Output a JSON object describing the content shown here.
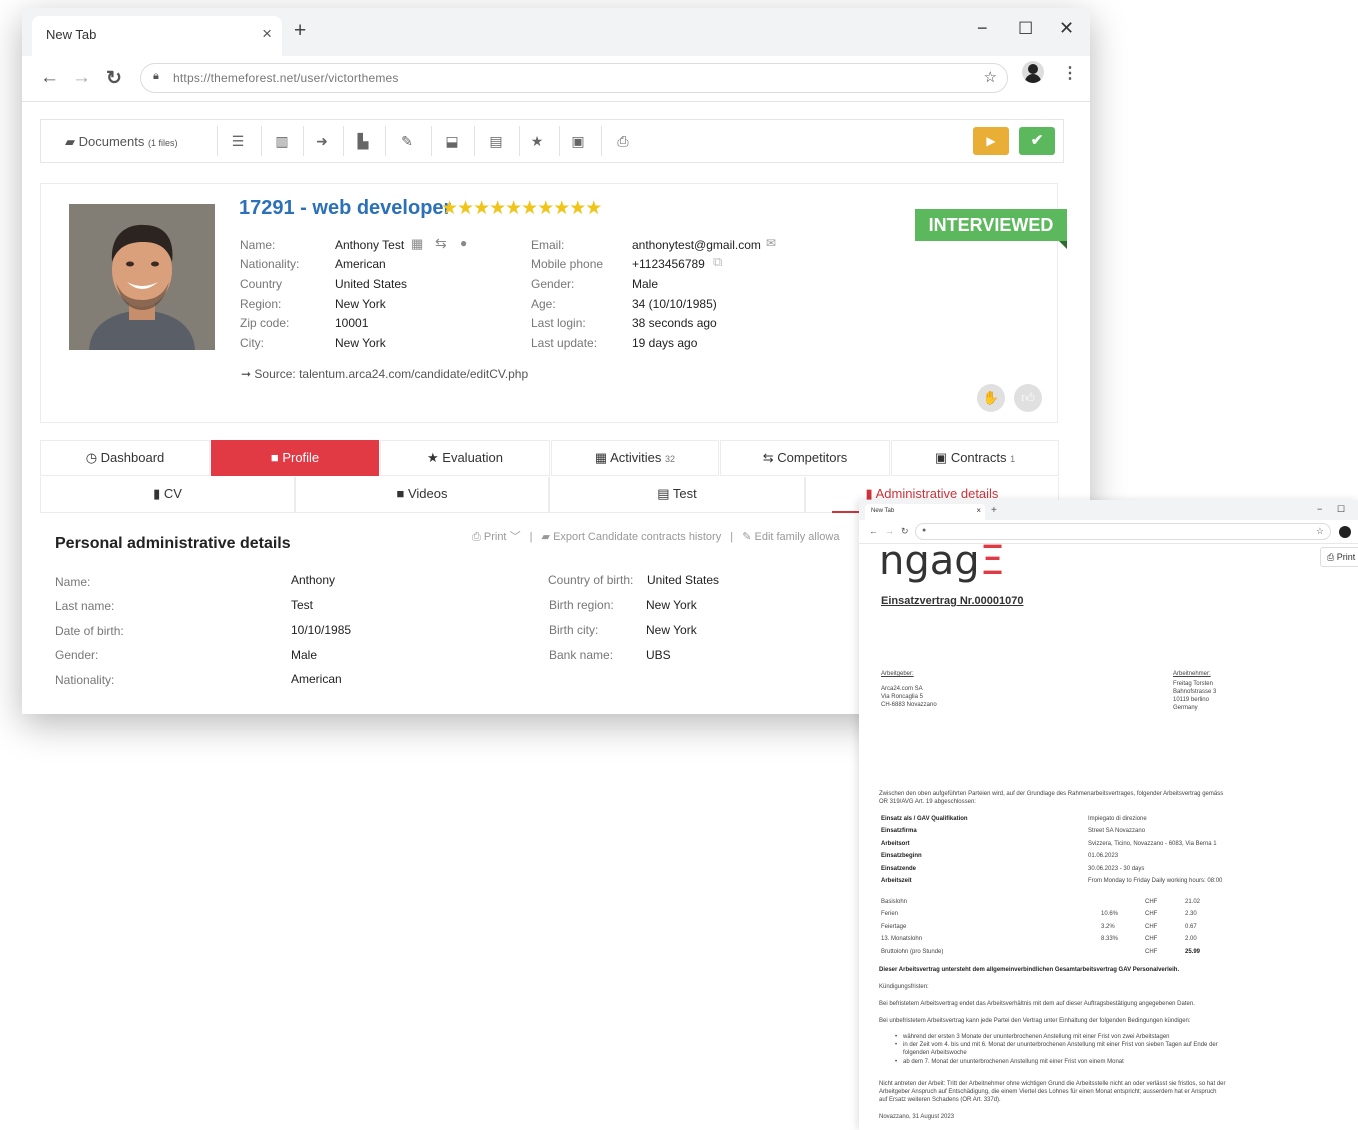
{
  "browser": {
    "tab_title": "New Tab",
    "tab_close": "×",
    "new_tab": "+",
    "url": "https://themeforest.net/user/victorthemes",
    "win_min": "−",
    "win_max": "☐",
    "win_close": "✕"
  },
  "toolbar": {
    "documents_label": "Documents",
    "documents_count": "(1 files)",
    "icons": [
      "list-icon",
      "columns-icon",
      "share-icon",
      "document-icon",
      "edit-icon",
      "export-icon",
      "notes-icon",
      "star-icon",
      "camera-icon",
      "print-icon"
    ]
  },
  "candidate": {
    "id_title": "17291 - web developer",
    "stars": "★★★★★★★★★★",
    "status": "INTERVIEWED",
    "left_labels": [
      "Name:",
      "Nationality:",
      "Country",
      "Region:",
      "Zip code:",
      "City:"
    ],
    "left_values": [
      "Anthony Test",
      "American",
      "United States",
      "New York",
      "10001",
      "New York"
    ],
    "right_labels": [
      "Email:",
      "Mobile phone",
      "Gender:",
      "Age:",
      "Last login:",
      "Last update:"
    ],
    "right_values": [
      "anthonytest@gmail.com",
      "+1123456789",
      "Male",
      "34 (10/10/1985)",
      "38 seconds ago",
      "19 days ago"
    ],
    "source": "➞ Source: talentum.arca24.com/candidate/editCV.php"
  },
  "tabs_row1": [
    {
      "icon": "◷",
      "label": "Dashboard",
      "badge": ""
    },
    {
      "icon": "■",
      "label": "Profile",
      "badge": ""
    },
    {
      "icon": "★",
      "label": "Evaluation",
      "badge": ""
    },
    {
      "icon": "▦",
      "label": "Activities",
      "badge": "32"
    },
    {
      "icon": "⇆",
      "label": "Competitors",
      "badge": ""
    },
    {
      "icon": "▣",
      "label": "Contracts",
      "badge": "1"
    }
  ],
  "tabs_row2": [
    {
      "icon": "▮",
      "label": "CV"
    },
    {
      "icon": "■",
      "label": "Videos"
    },
    {
      "icon": "▤",
      "label": "Test"
    },
    {
      "icon": "▮",
      "label": "Administrative details"
    }
  ],
  "admin": {
    "title": "Personal administrative details",
    "print": "Print",
    "export": "Export Candidate contracts history",
    "edit_family": "Edit family allowa",
    "left_labels": [
      "Name:",
      "Last name:",
      "Date of birth:",
      "Gender:",
      "Nationality:"
    ],
    "left_values": [
      "Anthony",
      "Test",
      "10/10/1985",
      "Male",
      "American"
    ],
    "right_labels": [
      "Country of birth:",
      "Birth region:",
      "Birth city:",
      "Bank name:"
    ],
    "right_values": [
      "United States",
      "New York",
      "New York",
      "UBS"
    ]
  },
  "doc_window": {
    "tab_title": "New Tab",
    "print": "Print",
    "logo_main": "ngag",
    "logo_end": "Ξ",
    "contract_title": "Einsatzvertrag Nr.00001070",
    "employer_label": "Arbeitgeber:",
    "employer_lines": [
      "Arca24.com SA",
      "Via Roncaglia 5",
      "CH-6883 Novazzano"
    ],
    "employee_label": "Arbeitnehmer:",
    "employee_lines": [
      "Freitag Torsten",
      "Bahnofstrasse 3",
      "10119 berlino",
      "Germany"
    ],
    "intro": [
      "Zwischen den oben aufgeführten Parteien wird, auf der Grundlage des Rahmenarbeitsvertrages, folgender Arbeitsvertrag gemäss",
      "OR 319/AVG Art. 19 abgeschlossen:"
    ],
    "details": [
      {
        "k": "Einsatz als / GAV Qualifikation",
        "v": "Impiegato di direzione"
      },
      {
        "k": "Einsatzfirma",
        "v": "Street SA Novazzano"
      },
      {
        "k": "Arbeitsort",
        "v": "Svizzera, Ticino, Novazzano - 6083, Via Berna 1"
      },
      {
        "k": "Einsatzbeginn",
        "v": "01.06.2023"
      },
      {
        "k": "Einsatzende",
        "v": "30.06.2023 - 30 days"
      },
      {
        "k": "Arbeitszeit",
        "v": "From Monday to Friday Daily working hours: 08:00"
      }
    ],
    "wages": [
      {
        "k": "Basislohn",
        "p": "",
        "c": "CHF",
        "v": "21.02"
      },
      {
        "k": "Ferien",
        "p": "10.6%",
        "c": "CHF",
        "v": "2.30"
      },
      {
        "k": "Feiertage",
        "p": "3.2%",
        "c": "CHF",
        "v": "0.67"
      },
      {
        "k": "13. Monatslohn",
        "p": "8.33%",
        "c": "CHF",
        "v": "2.00"
      },
      {
        "k": "Bruttolohn (pro Stunde)",
        "p": "",
        "c": "CHF",
        "v": "25.99"
      }
    ],
    "gav_line": "Dieser Arbeitsvertrag untersteht dem allgemeinverbindlichen Gesamtarbeitsvertrag GAV Personalverleih.",
    "kuendigung": "Kündigungsfristen:",
    "befristet": "Bei befristetem Arbeitsvertrag endet das Arbeitsverhältnis mit dem auf dieser Auftragsbestätigung angegebenen Daten.",
    "unbefristet": "Bei unbefristetem Arbeitsvertrag kann jede Partei den Vertrag unter Einhaltung der folgenden Bedingungen kündigen:",
    "bullets": [
      "während der ersten 3 Monate der ununterbrochenen Anstellung mit einer Frist von zwei Arbeitstagen",
      "in der Zeit vom 4. bis und mit 6. Monat der ununterbrochenen Anstellung mit einer Frist von sieben Tagen auf Ende der",
      "folgenden Arbeitswoche",
      "ab dem 7. Monat der ununterbrochenen Anstellung mit einer Frist von einem Monat"
    ],
    "nicht_antreten": [
      "Nicht antreten der Arbeit: Tritt der Arbeitnehmer ohne wichtigen Grund die Arbeitsstelle nicht an oder verlässt sie fristlos, so hat der",
      "Arbeitgeber Anspruch auf Entschädigung, die einem Viertel des Lohnes für einen Monat entspricht; ausserdem hat er Anspruch",
      "auf Ersatz weiteren Schadens (OR Art. 337d)."
    ],
    "place_date": "Novazzano, 31 August 2023"
  }
}
